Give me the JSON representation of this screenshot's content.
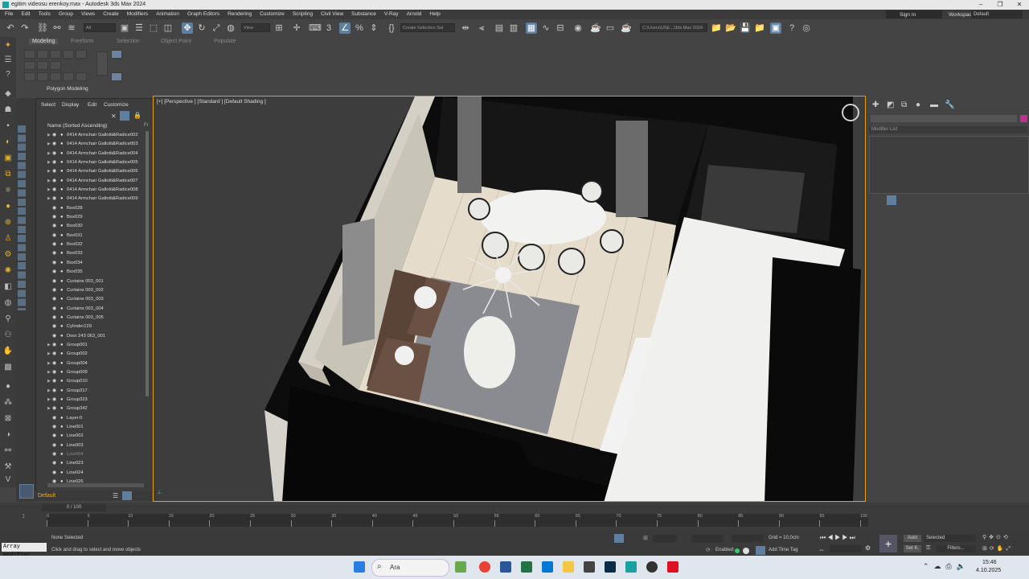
{
  "window": {
    "title": "egitim videosu erenkoy.max - Autodesk 3ds Max 2024"
  },
  "menu": [
    "File",
    "Edit",
    "Tools",
    "Group",
    "Views",
    "Create",
    "Modifiers",
    "Animation",
    "Graph Editors",
    "Rendering",
    "Customize",
    "Scripting",
    "Civil View",
    "Substance",
    "V-Ray",
    "Arnold",
    "Help"
  ],
  "account": {
    "signin": "Sign In",
    "workspaces_label": "Workspaces:",
    "workspace": "Default"
  },
  "toolbar": {
    "filter": "All",
    "view": "View",
    "selection_set": "Create Selection Set",
    "path": "C:\\Users\\USE...\\3ds Max 2024"
  },
  "ribbon": {
    "tabs": [
      "Modeling",
      "Freeform",
      "Selection",
      "Object Paint",
      "Populate"
    ],
    "group": "Polygon Modeling"
  },
  "explorer": {
    "menu": [
      "Select",
      "Display",
      "Edit",
      "Customize"
    ],
    "header": "Name (Sorted Ascending)",
    "header_right": "Fr",
    "rows": [
      {
        "name": "0414 Armchair Gallotti&Radice002",
        "exp": true
      },
      {
        "name": "0414 Armchair Gallotti&Radice003",
        "exp": true
      },
      {
        "name": "0414 Armchair Gallotti&Radice004",
        "exp": true
      },
      {
        "name": "0414 Armchair Gallotti&Radice005",
        "exp": true
      },
      {
        "name": "0414 Armchair Gallotti&Radice006",
        "exp": true
      },
      {
        "name": "0414 Armchair Gallotti&Radice007",
        "exp": true
      },
      {
        "name": "0414 Armchair Gallotti&Radice008",
        "exp": true
      },
      {
        "name": "0414 Armchair Gallotti&Radice009",
        "exp": true
      },
      {
        "name": "Box028"
      },
      {
        "name": "Box029"
      },
      {
        "name": "Box030"
      },
      {
        "name": "Box031"
      },
      {
        "name": "Box032"
      },
      {
        "name": "Box033"
      },
      {
        "name": "Box034"
      },
      {
        "name": "Box035"
      },
      {
        "name": "Curtains 003_001"
      },
      {
        "name": "Curtains 003_002"
      },
      {
        "name": "Curtains 003_003"
      },
      {
        "name": "Curtains 003_004"
      },
      {
        "name": "Curtains 003_005"
      },
      {
        "name": "Cylinder129"
      },
      {
        "name": "Door 243 063_001"
      },
      {
        "name": "Group001",
        "exp": true
      },
      {
        "name": "Group002",
        "exp": true
      },
      {
        "name": "Group004",
        "exp": true
      },
      {
        "name": "Group009",
        "exp": true
      },
      {
        "name": "Group010",
        "exp": true
      },
      {
        "name": "Group317",
        "exp": true
      },
      {
        "name": "Group323",
        "exp": true
      },
      {
        "name": "Group342",
        "exp": true
      },
      {
        "name": "Layer:0"
      },
      {
        "name": "Line001"
      },
      {
        "name": "Line002"
      },
      {
        "name": "Line003"
      },
      {
        "name": "Line004",
        "dim": true
      },
      {
        "name": "Line023"
      },
      {
        "name": "Line024"
      },
      {
        "name": "Line026"
      }
    ]
  },
  "layer": {
    "name": "Default"
  },
  "viewport": {
    "label": "[+] [Perspective ] [Standard ] [Default Shading ]"
  },
  "command_panel": {
    "modifier_list": "Modifier List"
  },
  "timeline": {
    "frame": "0 / 100",
    "ticks": [
      "0",
      "5",
      "10",
      "15",
      "20",
      "25",
      "30",
      "35",
      "40",
      "45",
      "50",
      "55",
      "60",
      "65",
      "70",
      "75",
      "80",
      "85",
      "90",
      "95",
      "100"
    ]
  },
  "status": {
    "maxscript": "Array modifier",
    "selection": "None Selected",
    "prompt": "Click and drag to select and move objects",
    "grid": "Grid = 10,0cm",
    "enabled": "Enabled:",
    "add_time_tag": "Add Time Tag",
    "auto": "Auto",
    "selected": "Selected",
    "set_key": "Set K.",
    "filters": "Filters..."
  },
  "taskbar": {
    "search": "Ara",
    "time": "15:46",
    "date": "4.10.2025"
  }
}
